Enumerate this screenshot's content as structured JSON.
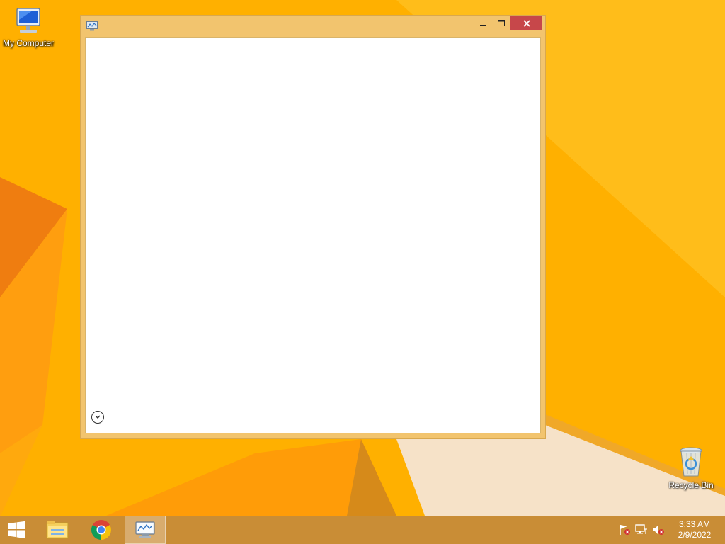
{
  "desktop": {
    "icons": [
      {
        "label": "My Computer",
        "icon": "computer-icon"
      },
      {
        "label": "Recycle Bin",
        "icon": "recycle-bin-icon"
      }
    ],
    "wallpaper_color": "#ffb300"
  },
  "window": {
    "title": "",
    "icon": "performance-monitor-icon",
    "controls": [
      "minimize",
      "maximize",
      "close"
    ],
    "close_color": "#c7474a",
    "expand_control": "chevron-down-circle-icon"
  },
  "taskbar": {
    "buttons": [
      {
        "name": "start",
        "icon": "windows-logo-icon"
      },
      {
        "name": "file-explorer",
        "icon": "folder-icon"
      },
      {
        "name": "chrome",
        "icon": "chrome-icon"
      },
      {
        "name": "performance-monitor",
        "icon": "performance-monitor-icon",
        "active": true
      }
    ],
    "tray": [
      "action-center-flag-icon",
      "network-icon",
      "volume-muted-icon"
    ],
    "clock": {
      "time": "3:33 AM",
      "date": "2/9/2022"
    }
  }
}
